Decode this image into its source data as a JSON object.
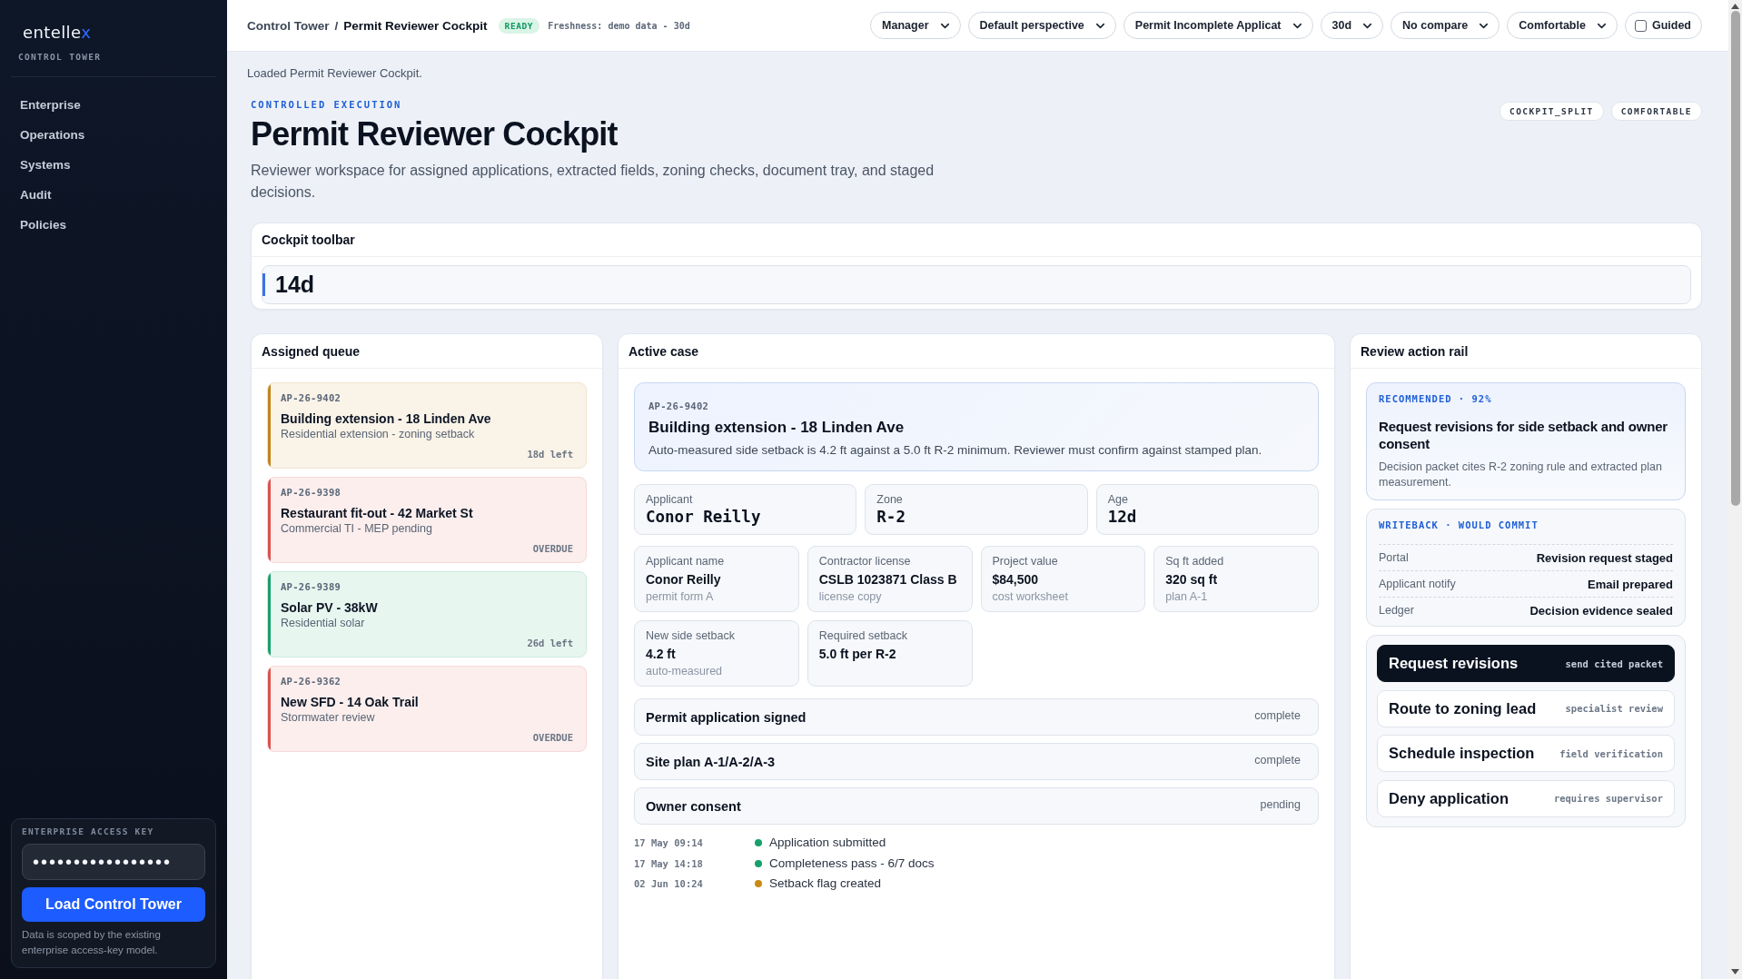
{
  "sidebar": {
    "logo": {
      "text": "entelle",
      "accent": "x"
    },
    "subtitle": "CONTROL TOWER",
    "nav": [
      "Enterprise",
      "Operations",
      "Systems",
      "Audit",
      "Policies"
    ],
    "access_key": {
      "label": "ENTERPRISE ACCESS KEY",
      "value": "•••••••••••••••••",
      "button": "Load Control Tower",
      "note": "Data is scoped by the existing enterprise access-key model."
    }
  },
  "header": {
    "breadcrumb": [
      "Control Tower",
      "Permit Reviewer Cockpit"
    ],
    "separator": "/",
    "status": "READY",
    "freshness": "Freshness: demo data - 30d",
    "dropdowns": [
      "Manager",
      "Default perspective",
      "Permit Incomplete Applicat",
      "30d",
      "No compare",
      "Comfortable"
    ],
    "guided": {
      "label": "Guided",
      "checked": false
    }
  },
  "notice": "Loaded Permit Reviewer Cockpit.",
  "hero": {
    "eyebrow": "CONTROLLED EXECUTION",
    "title": "Permit Reviewer Cockpit",
    "description": "Reviewer workspace for assigned applications, extracted fields, zoning checks, document tray, and staged decisions.",
    "tags": [
      "COCKPIT_SPLIT",
      "COMFORTABLE"
    ]
  },
  "toolbar": {
    "title": "Cockpit toolbar",
    "value": "14d"
  },
  "queue": {
    "title": "Assigned queue",
    "items": [
      {
        "id": "AP-26-9402",
        "title": "Building extension - 18 Linden Ave",
        "subtitle": "Residential extension - zoning setback",
        "due": "18d left",
        "color": "#c0841a"
      },
      {
        "id": "AP-26-9398",
        "title": "Restaurant fit-out - 42 Market St",
        "subtitle": "Commercial TI - MEP pending",
        "due": "OVERDUE",
        "color": "#d9534f"
      },
      {
        "id": "AP-26-9389",
        "title": "Solar PV - 38kW",
        "subtitle": "Residential solar",
        "due": "26d left",
        "color": "#16a06c"
      },
      {
        "id": "AP-26-9362",
        "title": "New SFD - 14 Oak Trail",
        "subtitle": "Stormwater review",
        "due": "OVERDUE",
        "color": "#d9534f"
      }
    ]
  },
  "active_case": {
    "title": "Active case",
    "summary": {
      "id": "AP-26-9402",
      "title": "Building extension - 18 Linden Ave",
      "description": "Auto-measured side setback is 4.2 ft against a 5.0 ft R-2 minimum. Reviewer must confirm against stamped plan."
    },
    "stats": [
      {
        "label": "Applicant",
        "value": "Conor Reilly"
      },
      {
        "label": "Zone",
        "value": "R-2"
      },
      {
        "label": "Age",
        "value": "12d"
      }
    ],
    "fields": [
      {
        "label": "Applicant name",
        "value": "Conor Reilly",
        "source": "permit form A"
      },
      {
        "label": "Contractor license",
        "value": "CSLB 1023871 Class B",
        "source": "license copy"
      },
      {
        "label": "Project value",
        "value": "$84,500",
        "source": "cost worksheet"
      },
      {
        "label": "Sq ft added",
        "value": "320 sq ft",
        "source": "plan A-1"
      },
      {
        "label": "New side setback",
        "value": "4.2 ft",
        "source": "auto-measured"
      },
      {
        "label": "Required setback",
        "value": "5.0 ft per R-2"
      }
    ],
    "documents": [
      {
        "name": "Permit application signed",
        "status": "complete"
      },
      {
        "name": "Site plan A-1/A-2/A-3",
        "status": "complete"
      },
      {
        "name": "Owner consent",
        "status": "pending"
      }
    ],
    "timeline": [
      {
        "time": "17 May 09:14",
        "text": "Application submitted",
        "color": "#16a06c"
      },
      {
        "time": "17 May 14:18",
        "text": "Completeness pass - 6/7 docs",
        "color": "#16a06c"
      },
      {
        "time": "02 Jun 10:24",
        "text": "Setback flag created",
        "color": "#c88a12"
      }
    ]
  },
  "action_rail": {
    "title": "Review action rail",
    "recommendation": {
      "tag": "RECOMMENDED · 92%",
      "title": "Request revisions for side setback and owner consent",
      "description": "Decision packet cites R-2 zoning rule and extracted plan measurement."
    },
    "writeback": {
      "title": "WRITEBACK · WOULD COMMIT",
      "rows": [
        {
          "label": "Portal",
          "value": "Revision request staged"
        },
        {
          "label": "Applicant notify",
          "value": "Email prepared"
        },
        {
          "label": "Ledger",
          "value": "Decision evidence sealed"
        }
      ]
    },
    "actions": [
      {
        "label": "Request revisions",
        "hint": "send cited packet",
        "kind": "primary"
      },
      {
        "label": "Route to zoning lead",
        "hint": "specialist review",
        "kind": "default"
      },
      {
        "label": "Schedule inspection",
        "hint": "field verification",
        "kind": "default"
      },
      {
        "label": "Deny application",
        "hint": "requires supervisor",
        "kind": "default"
      }
    ]
  }
}
